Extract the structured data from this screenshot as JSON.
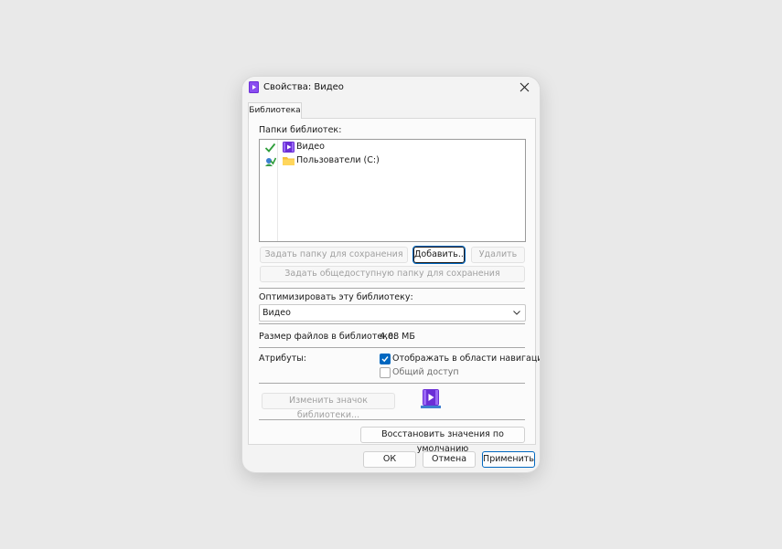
{
  "window": {
    "title": "Свойства: Видео",
    "icon": "video-library-icon"
  },
  "tabs": [
    {
      "label": "Библиотека",
      "selected": true
    }
  ],
  "folders": {
    "label_prefix": "Папки библиотек",
    "label_suffix": ":",
    "items": [
      {
        "name": "Видео",
        "status": "check-icon",
        "icon": "video-folder-icon"
      },
      {
        "name": "Пользователи (C:)",
        "status": "public-save-icon",
        "icon": "folder-icon"
      }
    ]
  },
  "buttons": {
    "set_save_folder": "Задать папку для сохранения",
    "add": "Добавить...",
    "remove": "Удалить",
    "set_public_save_folder": "Задать общедоступную папку для сохранения",
    "change_icon": "Изменить значок библиотеки...",
    "restore_defaults": "Восстановить значения по умолчанию",
    "ok": "ОК",
    "cancel": "Отмена",
    "apply": "Применить"
  },
  "optimize": {
    "label": "Оптимизировать эту библиотеку:",
    "selected": "Видео"
  },
  "size": {
    "label": "Размер файлов в библиотеке:",
    "value": "4,08 МБ"
  },
  "attributes": {
    "label": "Атрибуты:",
    "show_in_nav": {
      "label": "Отображать в области навигации",
      "checked": true
    },
    "shared": {
      "label": "Общий доступ",
      "checked": false
    }
  },
  "colors": {
    "accent": "#0067c0",
    "library_purple": "#6b2fd6"
  }
}
